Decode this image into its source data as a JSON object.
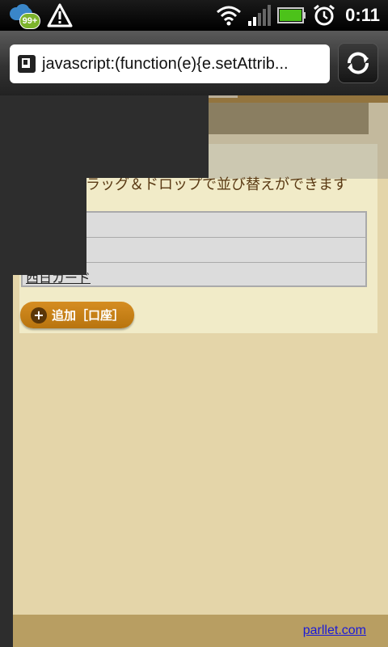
{
  "status_bar": {
    "notification_badge": "99+",
    "time": "0:11",
    "icons": [
      "cloud-sync-icon",
      "warning-icon",
      "wifi-icon",
      "signal-icon",
      "battery-icon",
      "alarm-icon"
    ]
  },
  "browser": {
    "url": "javascript:(function(e){e.setAttrib...",
    "refresh_icon": "refresh-icon"
  },
  "page": {
    "instruction": "ラッグ＆ドロップで並び替えができます",
    "list_rows": [
      "",
      "",
      "西日カード"
    ],
    "add_button": "追加［口座］",
    "add_icon": "+",
    "footer_link": "parllet.com"
  },
  "colors": {
    "page_bg": "#e4d5a9",
    "panel_bg": "#f1ebc8",
    "button": "#c9821a",
    "footer": "#b89e62",
    "link": "#1a1ad8"
  }
}
